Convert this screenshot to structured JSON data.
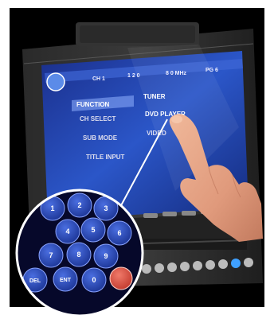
{
  "screen": {
    "header": {
      "channel": "CH 1",
      "display": "1 2 0",
      "frequency": "8 0 MHz",
      "page": "PG 6"
    },
    "menu_items": [
      "FUNCTION",
      "CH SELECT",
      "SUB MODE",
      "TITLE INPUT"
    ],
    "right_items": [
      "TUNER",
      "DVD PLAYER",
      "VIDEO"
    ]
  },
  "keypad": {
    "keys": [
      "1",
      "2",
      "3",
      "4",
      "5",
      "6",
      "7",
      "8",
      "9",
      "DEL",
      "ENT",
      "0"
    ]
  },
  "colors": {
    "background": "#000000",
    "screen": "#1b3fa8",
    "key": "#2447b8",
    "accent_key": "#d84a3c",
    "finger": "#e2a083"
  }
}
